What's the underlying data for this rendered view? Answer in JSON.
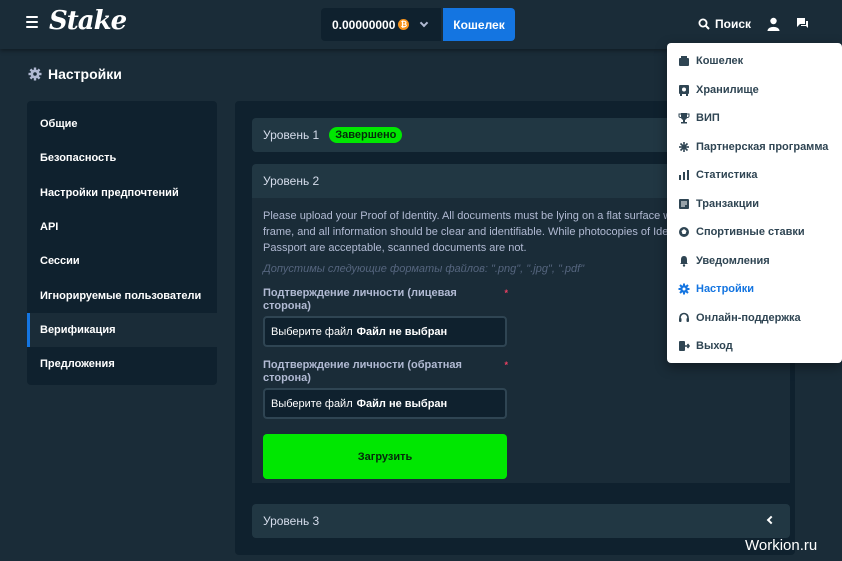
{
  "header": {
    "logo": "Stake",
    "balance": "0.00000000",
    "coin_symbol": "₿",
    "wallet_button": "Кошелек",
    "search_label": "Поиск"
  },
  "page": {
    "title": "Настройки"
  },
  "sidebar": {
    "items": [
      {
        "label": "Общие"
      },
      {
        "label": "Безопасность"
      },
      {
        "label": "Настройки предпочтений"
      },
      {
        "label": "API"
      },
      {
        "label": "Сессии"
      },
      {
        "label": "Игнорируемые пользователи"
      },
      {
        "label": "Верификация"
      },
      {
        "label": "Предложения"
      }
    ],
    "active_index": 6
  },
  "verification": {
    "level1": {
      "title": "Уровень 1",
      "badge": "Завершено"
    },
    "level2": {
      "title": "Уровень 2",
      "info": "Please upload your Proof of Identity. All documents must be lying on a flat surface with all 4 corners inside the frame, and all information should be clear and identifiable. While photocopies of Identity Card, Driver's License and Passport are acceptable, scanned documents are not.",
      "formats": "Допустимы следующие форматы файлов: \".png\", \".jpg\", \".pdf\"",
      "front_label": "Подтверждение личности (лицевая сторона)",
      "back_label": "Подтверждение личности (обратная сторона)",
      "required_mark": "*",
      "choose_file": "Выберите файл",
      "no_file": "Файл не выбран",
      "upload_button": "Загрузить"
    },
    "level3": {
      "title": "Уровень 3"
    }
  },
  "dropdown": {
    "items": [
      {
        "label": "Кошелек",
        "icon": "wallet-icon"
      },
      {
        "label": "Хранилище",
        "icon": "vault-icon"
      },
      {
        "label": "ВИП",
        "icon": "trophy-icon"
      },
      {
        "label": "Партнерская программа",
        "icon": "affiliate-icon"
      },
      {
        "label": "Статистика",
        "icon": "statistics-icon"
      },
      {
        "label": "Транзакции",
        "icon": "transactions-icon"
      },
      {
        "label": "Спортивные ставки",
        "icon": "sports-ball-icon"
      },
      {
        "label": "Уведомления",
        "icon": "bell-icon"
      },
      {
        "label": "Настройки",
        "icon": "gear-icon"
      },
      {
        "label": "Онлайн-поддержка",
        "icon": "headset-icon"
      },
      {
        "label": "Выход",
        "icon": "logout-icon"
      }
    ],
    "active_index": 8
  },
  "colors": {
    "accent_blue": "#1475e1",
    "success_green": "#00e701",
    "background": "#1a2c38",
    "panel": "#0f212e"
  },
  "watermark": "Workion.ru"
}
